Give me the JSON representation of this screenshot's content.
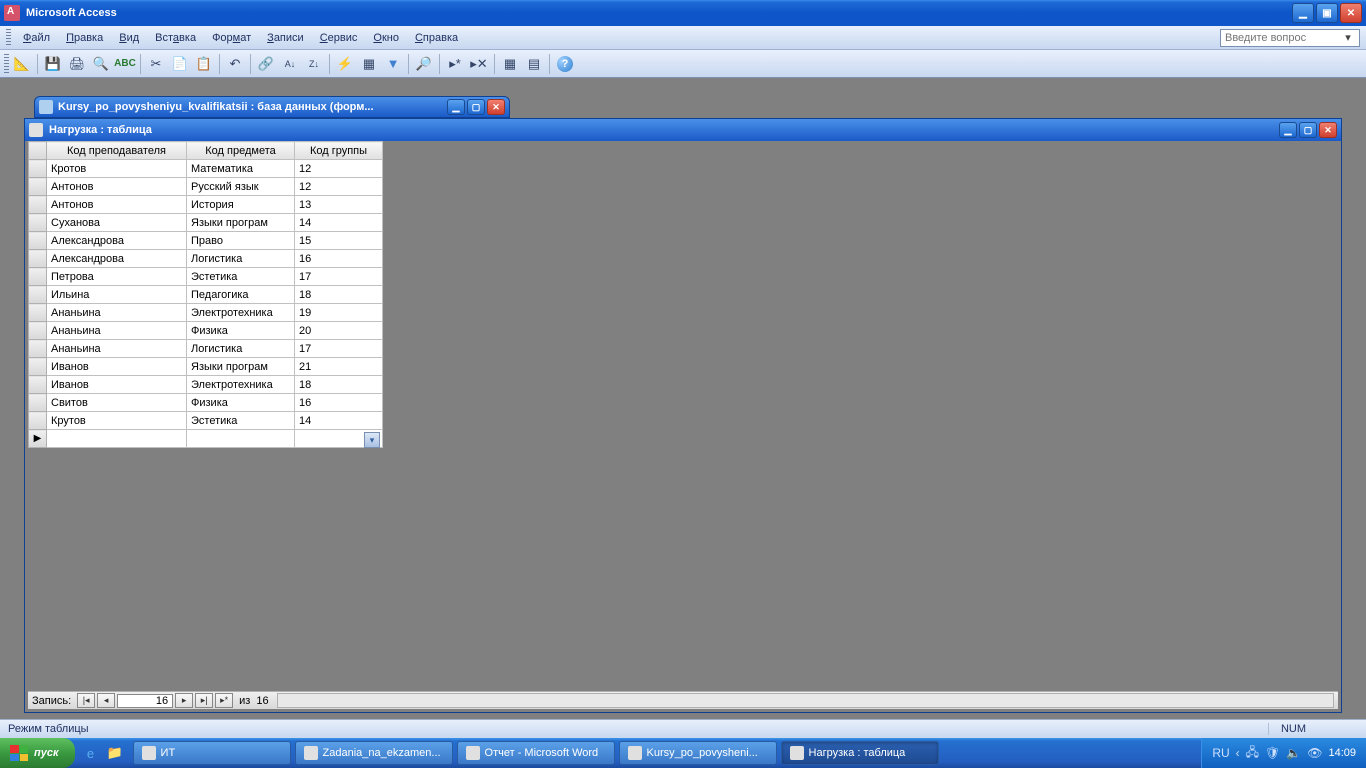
{
  "app_title": "Microsoft Access",
  "menu": [
    "Файл",
    "Правка",
    "Вид",
    "Вставка",
    "Формат",
    "Записи",
    "Сервис",
    "Окно",
    "Справка"
  ],
  "ask_placeholder": "Введите вопрос",
  "db_window_title": "Kursy_po_povysheniyu_kvalifikatsii : база данных (форм...",
  "table_window_title": "Нагрузка : таблица",
  "columns": [
    "Код преподавателя",
    "Код предмета",
    "Код группы"
  ],
  "rows": [
    {
      "teacher": "Кротов",
      "subject": "Математика",
      "group": "12"
    },
    {
      "teacher": "Антонов",
      "subject": "Русский язык",
      "group": "12"
    },
    {
      "teacher": "Антонов",
      "subject": "История",
      "group": "13"
    },
    {
      "teacher": "Суханова",
      "subject": "Языки програм",
      "group": "14"
    },
    {
      "teacher": "Александрова",
      "subject": "Право",
      "group": "15"
    },
    {
      "teacher": "Александрова",
      "subject": "Логистика",
      "group": "16"
    },
    {
      "teacher": "Петрова",
      "subject": "Эстетика",
      "group": "17"
    },
    {
      "teacher": "Ильина",
      "subject": "Педагогика",
      "group": "18"
    },
    {
      "teacher": "Ананьина",
      "subject": "Электротехника",
      "group": "19"
    },
    {
      "teacher": "Ананьина",
      "subject": "Физика",
      "group": "20"
    },
    {
      "teacher": "Ананьина",
      "subject": "Логистика",
      "group": "17"
    },
    {
      "teacher": "Иванов",
      "subject": "Языки програм",
      "group": "21"
    },
    {
      "teacher": "Иванов",
      "subject": "Электротехника",
      "group": "18"
    },
    {
      "teacher": "Свитов",
      "subject": "Физика",
      "group": "16"
    },
    {
      "teacher": "Крутов",
      "subject": "Эстетика",
      "group": "14"
    }
  ],
  "recnav": {
    "label": "Запись:",
    "current": "16",
    "of_label": "из",
    "total": "16"
  },
  "statusbar": {
    "mode": "Режим таблицы",
    "numlock": "NUM"
  },
  "taskbar": {
    "start": "пуск",
    "buttons": [
      {
        "label": "ИТ",
        "active": false
      },
      {
        "label": "Zadania_na_ekzamen...",
        "active": false
      },
      {
        "label": "Отчет - Microsoft Word",
        "active": false
      },
      {
        "label": "Kursy_po_povysheni...",
        "active": false
      },
      {
        "label": "Нагрузка : таблица",
        "active": true
      }
    ],
    "lang": "RU",
    "clock": "14:09"
  }
}
